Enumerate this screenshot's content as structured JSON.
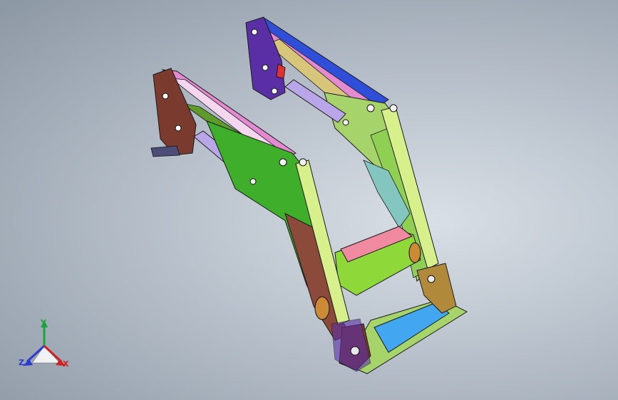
{
  "viewport": {
    "background_top": "#d9dfe6",
    "background_edge": "#8c97a4"
  },
  "model": {
    "colors": {
      "boom_green": "#3fae2a",
      "boom_light_green": "#a6d46a",
      "top_beam_blue": "#2f4fd8",
      "top_beam_pink": "#e48ad0",
      "bracket_purple": "#5a2fa6",
      "bracket_brown": "#7a3a2e",
      "cylinder_lavender": "#b8a6e8",
      "crossmember_pink": "#f08aa0",
      "crossmember_green": "#8ed83a",
      "cyan_plate": "#43a6f0",
      "yellow_lightgreen": "#d8f08c"
    }
  },
  "triad": {
    "y_label": "Y",
    "z_label": "Z",
    "x_label": "X",
    "colors": {
      "y": "#1aa33a",
      "z": "#2a3bd0",
      "x": "#d02020"
    }
  }
}
